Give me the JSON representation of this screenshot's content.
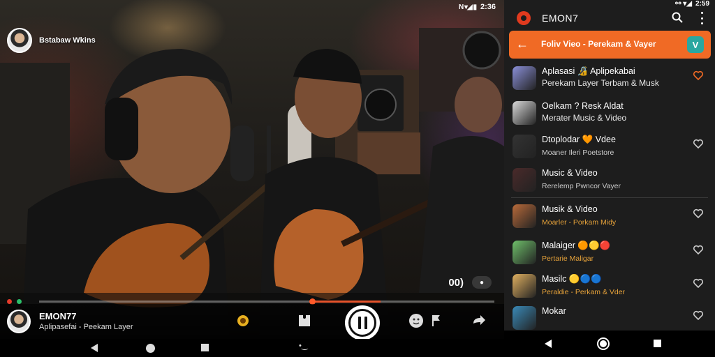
{
  "video": {
    "status": {
      "time": "2:36",
      "signal_icons": "N ▾◢ ▮"
    },
    "channel_label": "Bstabaw Wkins",
    "quality_label": "00)",
    "progress": {
      "played": 0.0,
      "position": 0.6,
      "buffered_to": 0.75
    },
    "now_playing": {
      "title": "EMON77",
      "subtitle": "Aplipasefai - Peekam Layer"
    },
    "controls": [
      "coin-icon",
      "puzzle-icon",
      "pause-icon",
      "emoji-icon",
      "flag-icon",
      "share-icon"
    ]
  },
  "panel": {
    "status": {
      "time": "2:59"
    },
    "app_title": "EMON7",
    "header_title": "Foliv Vieo - Perekam & Vayer",
    "header_icon_label": "V",
    "items": [
      {
        "line1": "Aplasasi 🔏 Aplipekabai",
        "line2": "Perekam Layer Terbam & Musk",
        "line2_style": "normal",
        "thumb": "#8a8fd8",
        "heart": "orange"
      },
      {
        "line1": "Oelkam ? Resk Aldat",
        "line2": "Merater Music & Video",
        "line2_style": "normal",
        "thumb": "#d9d9d9",
        "heart": "none"
      },
      {
        "line1": "Dtoplodar 🧡 Vdee",
        "line2": "Moaner Ileri Poetstore",
        "line2_style": "small",
        "thumb": "#333333",
        "heart": "grey"
      },
      {
        "line1": "Music & Video",
        "line2": "Rerelemp Pwncor Vayer",
        "line2_style": "small",
        "thumb": "#4a2a2a",
        "heart": "none"
      },
      {
        "line1": "Musik & Video",
        "line2": "Moarler - Porkam Midy",
        "line2_style": "accent-small",
        "thumb": "#b86a3a",
        "heart": "grey"
      },
      {
        "line1": "Malaiger 🟠🟡🔴",
        "line2": "Pertarie Maligar",
        "line2_style": "accent-small",
        "thumb": "#6fbf6a",
        "heart": "grey"
      },
      {
        "line1": "Masilc 🟡🔵🔵",
        "line2": "Peraldie - Perkam & Vder",
        "line2_style": "accent-small",
        "thumb": "#e0b060",
        "heart": "grey"
      },
      {
        "line1": "Mokar",
        "line2": "",
        "line2_style": "small",
        "thumb": "#3a8ab8",
        "heart": "grey"
      }
    ]
  },
  "colors": {
    "accent": "#f06a25",
    "progress": "#e5532b",
    "panel_bg": "#1d1d1d"
  }
}
